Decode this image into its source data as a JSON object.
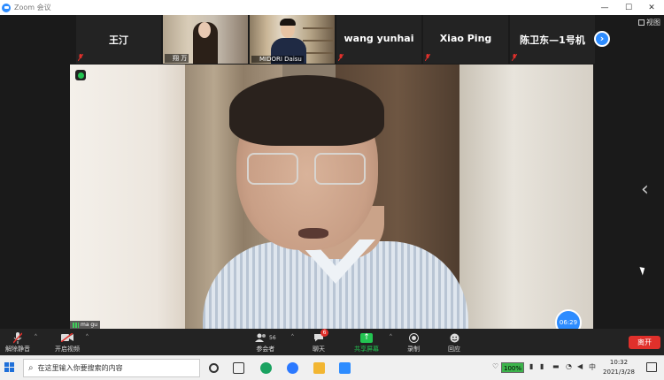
{
  "window": {
    "title": "Zoom 会议",
    "controls": [
      "—",
      "☐",
      "✕"
    ]
  },
  "view_button": {
    "label": "视图"
  },
  "participants_strip": [
    {
      "name": "王汀",
      "video": false
    },
    {
      "name": "翔 万",
      "video": true
    },
    {
      "name": "MIDORI Daisu",
      "video": true
    },
    {
      "name": "wang yunhai",
      "video": false
    },
    {
      "name": "Xiao Ping",
      "video": false
    },
    {
      "name": "陈卫东—1号机",
      "video": false
    }
  ],
  "next_page_icon": "chevron-right-icon",
  "main_video": {
    "speaker_label": "ma gu",
    "timer": "06:29"
  },
  "side_chevron": "‹",
  "controls": {
    "mute": {
      "label": "解除静音",
      "icon": "microphone-muted-icon"
    },
    "video": {
      "label": "开启视频",
      "icon": "video-off-icon"
    },
    "participants": {
      "label": "参会者",
      "count": "56"
    },
    "chat": {
      "label": "聊天",
      "badge": "6"
    },
    "share": {
      "label": "共享屏幕"
    },
    "record": {
      "label": "录制"
    },
    "reactions": {
      "label": "回应"
    },
    "leave": {
      "label": "离开"
    }
  },
  "taskbar": {
    "search_placeholder": "在这里输入你要搜索的内容",
    "battery": "100%",
    "ime": "中",
    "time": "10:32",
    "date": "2021/3/28"
  },
  "colors": {
    "accent": "#2d8cff",
    "leave": "#e0302b",
    "share": "#23c552"
  }
}
